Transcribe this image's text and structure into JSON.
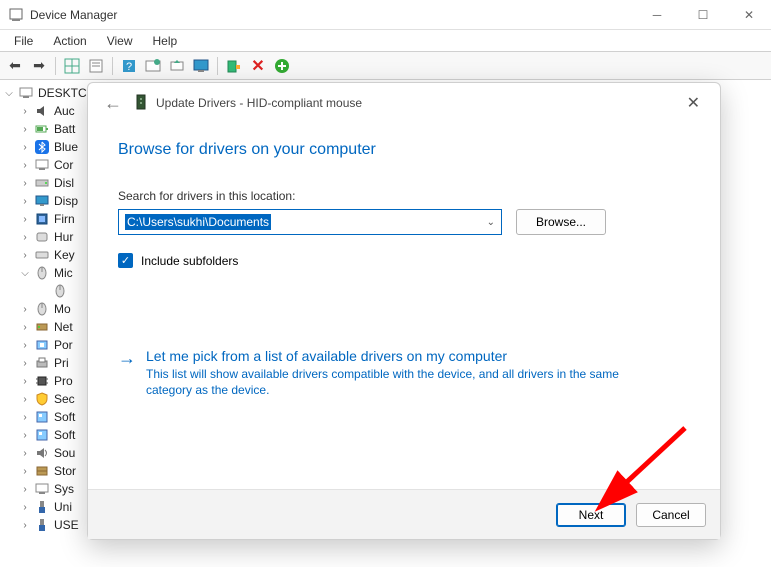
{
  "window": {
    "title": "Device Manager"
  },
  "menu": {
    "file": "File",
    "action": "Action",
    "view": "View",
    "help": "Help"
  },
  "tree": {
    "root": "DESKTC",
    "items": [
      {
        "label": "Auc",
        "chevron": ">"
      },
      {
        "label": "Batt",
        "chevron": ">"
      },
      {
        "label": "Blue",
        "chevron": ">"
      },
      {
        "label": "Cor",
        "chevron": ">"
      },
      {
        "label": "Disl",
        "chevron": ">"
      },
      {
        "label": "Disp",
        "chevron": ">"
      },
      {
        "label": "Firn",
        "chevron": ">"
      },
      {
        "label": "Hur",
        "chevron": ">"
      },
      {
        "label": "Key",
        "chevron": ">"
      },
      {
        "label": "Mic",
        "chevron": "v"
      },
      {
        "label": "Mo",
        "chevron": ">"
      },
      {
        "label": "Net",
        "chevron": ">"
      },
      {
        "label": "Por",
        "chevron": ">"
      },
      {
        "label": "Pri",
        "chevron": ">"
      },
      {
        "label": "Pro",
        "chevron": ">"
      },
      {
        "label": "Sec",
        "chevron": ">"
      },
      {
        "label": "Soft",
        "chevron": ">"
      },
      {
        "label": "Soft",
        "chevron": ">"
      },
      {
        "label": "Sou",
        "chevron": ">"
      },
      {
        "label": "Stor",
        "chevron": ">"
      },
      {
        "label": "Sys",
        "chevron": ">"
      },
      {
        "label": "Uni",
        "chevron": ">"
      },
      {
        "label": "USE",
        "chevron": ">"
      }
    ]
  },
  "dialog": {
    "title": "Update Drivers - HID-compliant mouse",
    "heading": "Browse for drivers on your computer",
    "search_label": "Search for drivers in this location:",
    "path_value": "C:\\Users\\sukhi\\Documents",
    "browse_label": "Browse...",
    "include_subfolders_label": "Include subfolders",
    "include_subfolders_checked": true,
    "pick_title": "Let me pick from a list of available drivers on my computer",
    "pick_desc": "This list will show available drivers compatible with the device, and all drivers in the same category as the device.",
    "next_label": "Next",
    "cancel_label": "Cancel"
  }
}
